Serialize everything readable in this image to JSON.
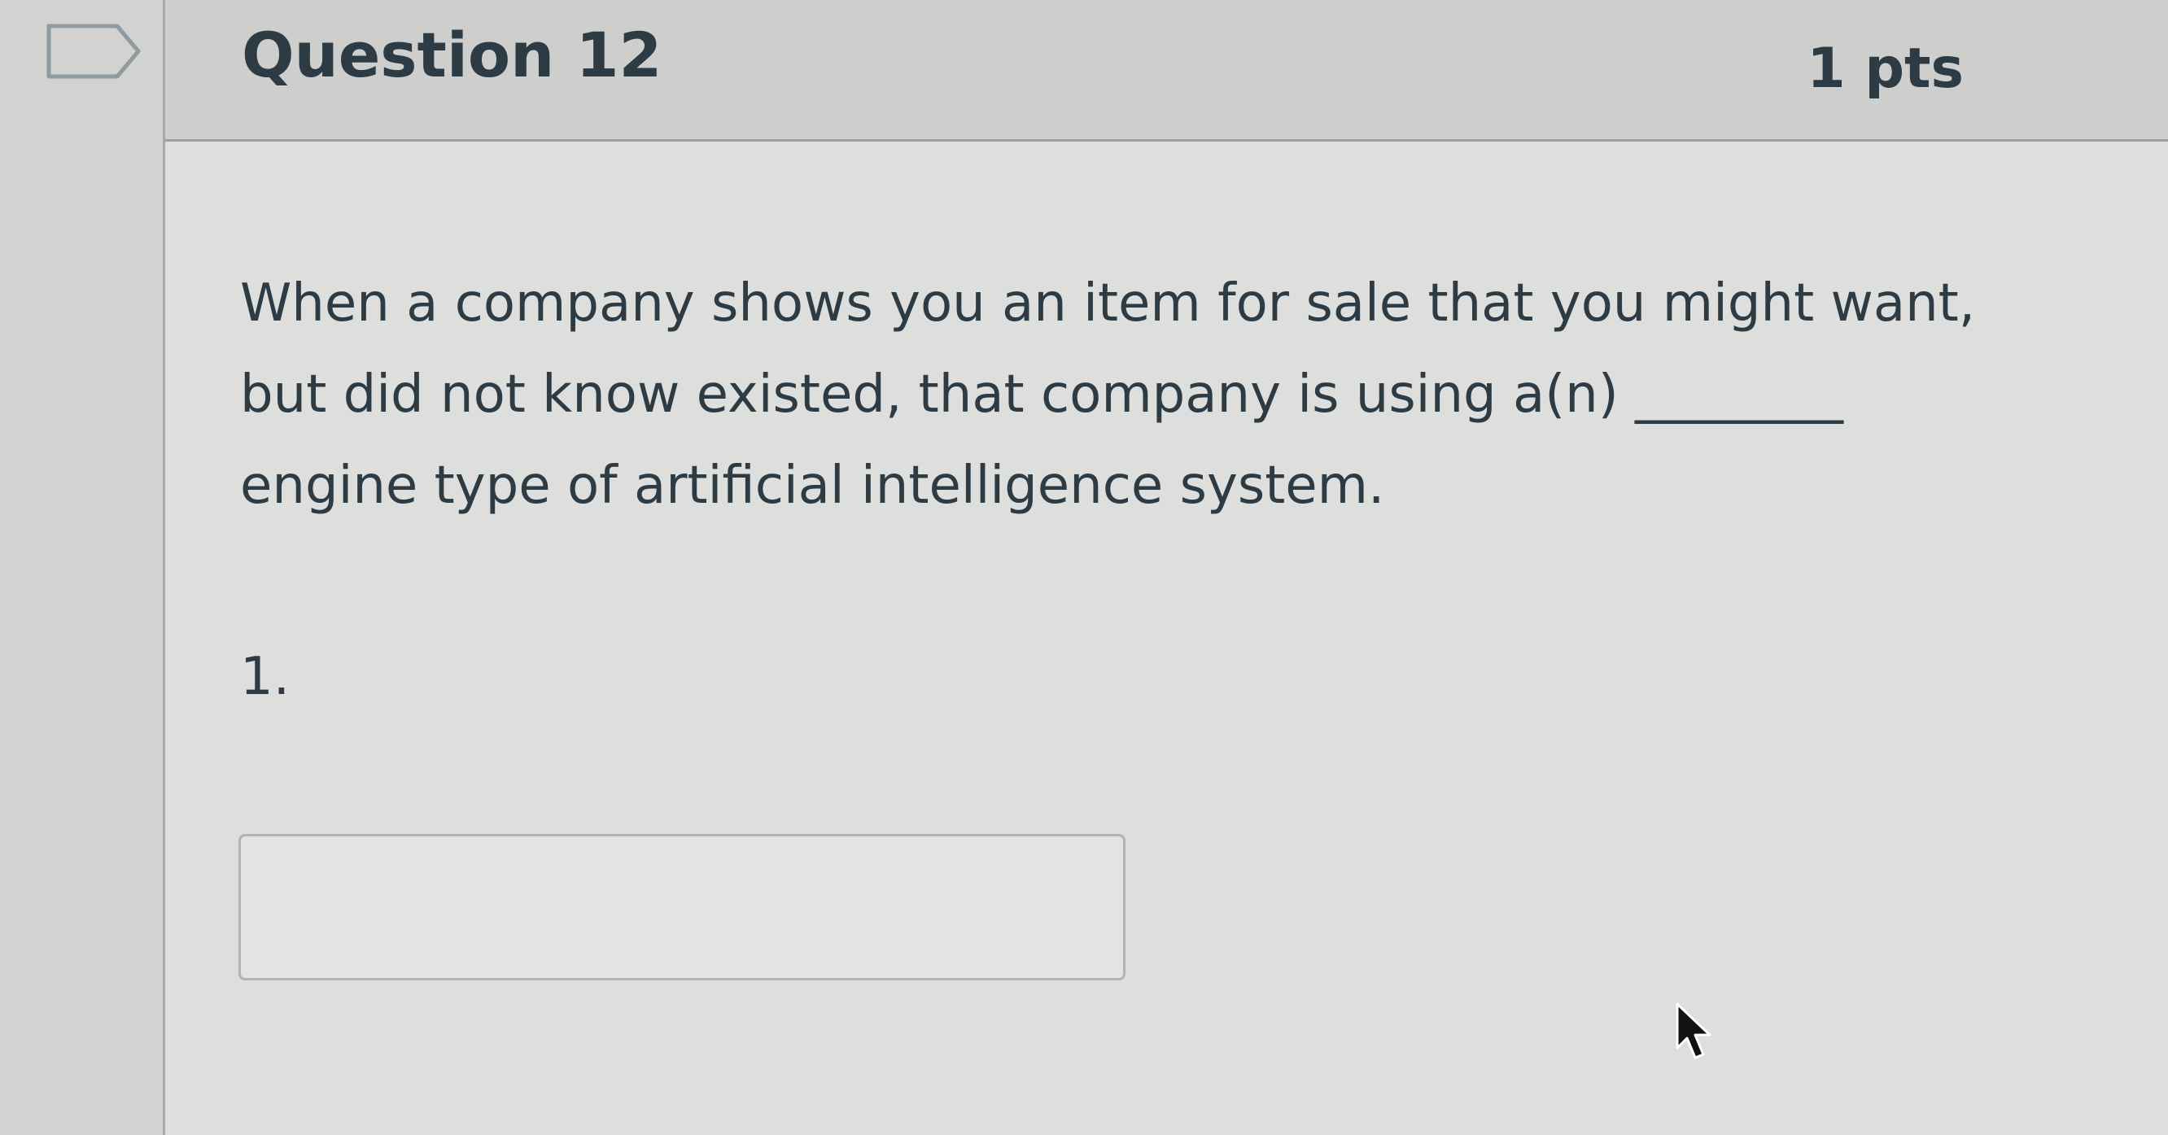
{
  "question": {
    "title": "Question 12",
    "points": "1 pts",
    "text_lines": [
      "When a company shows you an item for sale that you might want,",
      "but did not know existed, that company is using a(n) ________",
      "engine type of artificial intelligence system."
    ],
    "blank_number": "1.",
    "answer_value": ""
  },
  "icons": {
    "flag": "flag-icon",
    "cursor": "mouse-pointer-icon"
  },
  "colors": {
    "text": "#2d3b45",
    "header_bg": "#cececc",
    "card_bg": "#dededc",
    "border": "#9e9e9c"
  }
}
